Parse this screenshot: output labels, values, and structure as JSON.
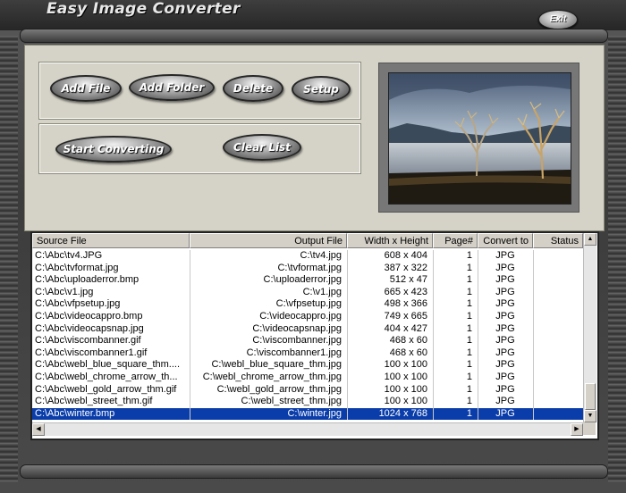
{
  "window": {
    "title": "Easy Image Converter",
    "exit_label": "Exit"
  },
  "toolbar": {
    "add_file": "Add File",
    "add_folder": "Add Folder",
    "delete": "Delete",
    "setup": "Setup",
    "start_converting": "Start Converting",
    "clear_list": "Clear List"
  },
  "preview": {
    "description_icon": "lake-landscape-image"
  },
  "list": {
    "columns": [
      "Source File",
      "Output File",
      "Width x Height",
      "Page#",
      "Convert to",
      "Status"
    ],
    "rows": [
      {
        "src": "C:\\Abc\\tv4.JPG",
        "out": "C:\\tv4.jpg",
        "wh": "608 x 404",
        "page": "1",
        "conv": "JPG"
      },
      {
        "src": "C:\\Abc\\tvformat.jpg",
        "out": "C:\\tvformat.jpg",
        "wh": "387 x 322",
        "page": "1",
        "conv": "JPG"
      },
      {
        "src": "C:\\Abc\\uploaderror.bmp",
        "out": "C:\\uploaderror.jpg",
        "wh": "512 x 47",
        "page": "1",
        "conv": "JPG"
      },
      {
        "src": "C:\\Abc\\v1.jpg",
        "out": "C:\\v1.jpg",
        "wh": "665 x 423",
        "page": "1",
        "conv": "JPG"
      },
      {
        "src": "C:\\Abc\\vfpsetup.jpg",
        "out": "C:\\vfpsetup.jpg",
        "wh": "498 x 366",
        "page": "1",
        "conv": "JPG"
      },
      {
        "src": "C:\\Abc\\videocappro.bmp",
        "out": "C:\\videocappro.jpg",
        "wh": "749 x 665",
        "page": "1",
        "conv": "JPG"
      },
      {
        "src": "C:\\Abc\\videocapsnap.jpg",
        "out": "C:\\videocapsnap.jpg",
        "wh": "404 x 427",
        "page": "1",
        "conv": "JPG"
      },
      {
        "src": "C:\\Abc\\viscombanner.gif",
        "out": "C:\\viscombanner.jpg",
        "wh": "468 x 60",
        "page": "1",
        "conv": "JPG"
      },
      {
        "src": "C:\\Abc\\viscombanner1.gif",
        "out": "C:\\viscombanner1.jpg",
        "wh": "468 x 60",
        "page": "1",
        "conv": "JPG"
      },
      {
        "src": "C:\\Abc\\webl_blue_square_thm....",
        "out": "C:\\webl_blue_square_thm.jpg",
        "wh": "100 x 100",
        "page": "1",
        "conv": "JPG"
      },
      {
        "src": "C:\\Abc\\webl_chrome_arrow_th...",
        "out": "C:\\webl_chrome_arrow_thm.jpg",
        "wh": "100 x 100",
        "page": "1",
        "conv": "JPG"
      },
      {
        "src": "C:\\Abc\\webl_gold_arrow_thm.gif",
        "out": "C:\\webl_gold_arrow_thm.jpg",
        "wh": "100 x 100",
        "page": "1",
        "conv": "JPG"
      },
      {
        "src": "C:\\Abc\\webl_street_thm.gif",
        "out": "C:\\webl_street_thm.jpg",
        "wh": "100 x 100",
        "page": "1",
        "conv": "JPG"
      },
      {
        "src": "C:\\Abc\\winter.bmp",
        "out": "C:\\winter.jpg",
        "wh": "1024 x 768",
        "page": "1",
        "conv": "JPG",
        "selected": true
      }
    ]
  },
  "colors": {
    "selection": "#0a3daa",
    "panel": "#d5d3c7"
  }
}
